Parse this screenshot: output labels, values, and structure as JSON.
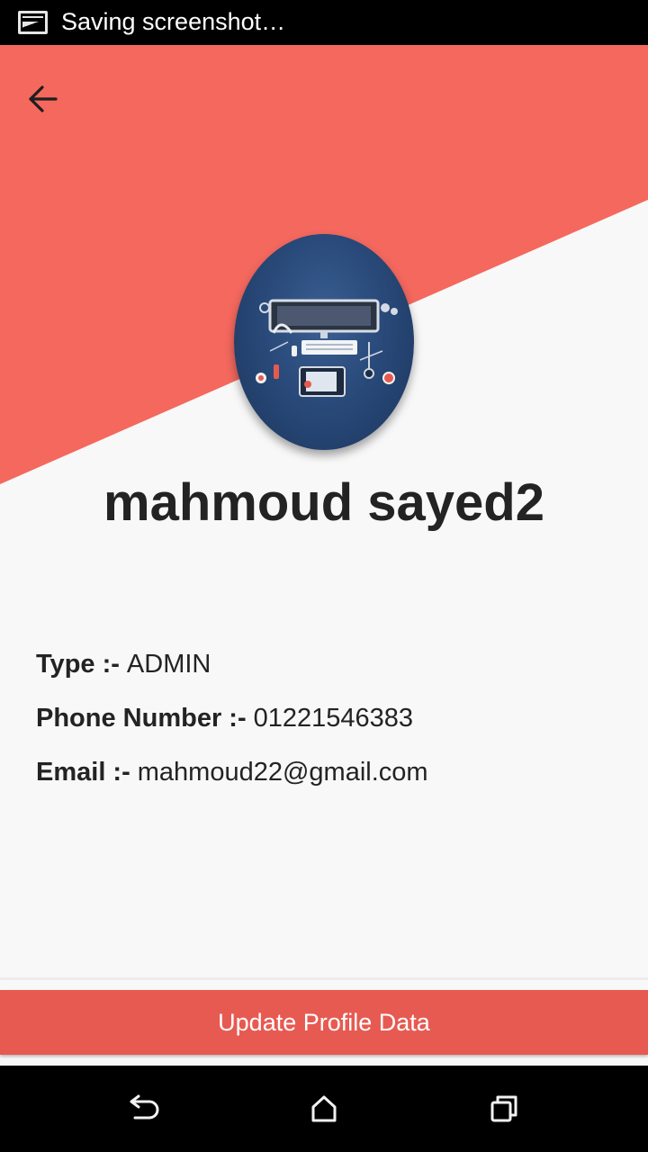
{
  "status_bar": {
    "icon": "screenshot-image-icon",
    "text": "Saving screenshot…"
  },
  "header": {
    "back_icon": "arrow-left-icon",
    "accent_color": "#f4685e"
  },
  "profile": {
    "avatar_icon": "workspace-illustration-avatar",
    "name": "mahmoud sayed2",
    "fields": [
      {
        "label": "Type :-",
        "value": "ADMIN"
      },
      {
        "label": "Phone Number :-",
        "value": "01221546383"
      },
      {
        "label": "Email :-",
        "value": "mahmoud22@gmail.com"
      }
    ]
  },
  "actions": {
    "update_label": "Update Profile Data",
    "button_color": "#e75a51"
  },
  "nav_bar": {
    "back_icon": "nav-back-icon",
    "home_icon": "nav-home-icon",
    "recents_icon": "nav-recents-icon"
  }
}
